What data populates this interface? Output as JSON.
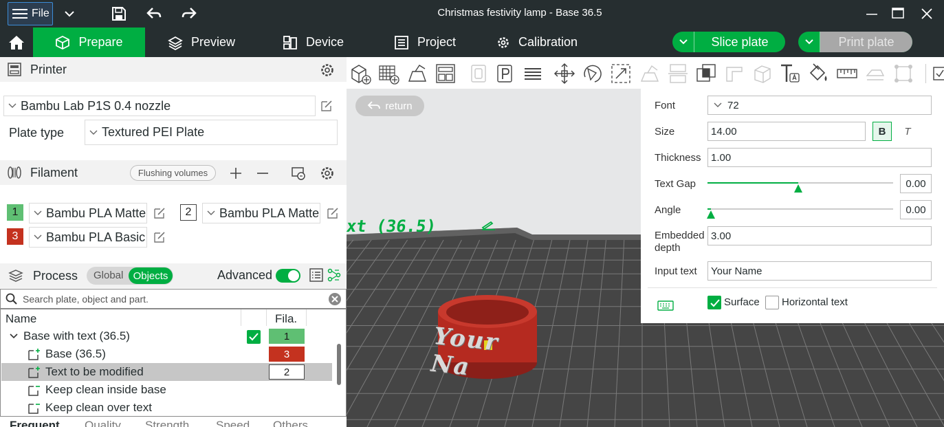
{
  "window": {
    "title": "Christmas festivity lamp - Base 36.5",
    "file_label": "File"
  },
  "menu": {
    "tabs": [
      {
        "label": "Prepare"
      },
      {
        "label": "Preview"
      },
      {
        "label": "Device"
      },
      {
        "label": "Project"
      },
      {
        "label": "Calibration"
      }
    ],
    "slice_label": "Slice plate",
    "print_label": "Print plate"
  },
  "printer": {
    "section_label": "Printer",
    "selected": "Bambu Lab P1S 0.4 nozzle",
    "plate_type_label": "Plate type",
    "plate_type": "Textured PEI Plate"
  },
  "filament": {
    "section_label": "Filament",
    "flushing_label": "Flushing volumes",
    "items": [
      {
        "num": "1",
        "name": "Bambu PLA Matte",
        "color": "#5fbf73"
      },
      {
        "num": "2",
        "name": "Bambu PLA Matte",
        "color": "#ffffff"
      },
      {
        "num": "3",
        "name": "Bambu PLA Basic",
        "color": "#c4321f"
      }
    ]
  },
  "process": {
    "section_label": "Process",
    "global_label": "Global",
    "objects_label": "Objects",
    "advanced_label": "Advanced",
    "search_placeholder": "Search plate, object and part."
  },
  "tree": {
    "col_name": "Name",
    "col_fila": "Fila.",
    "rows": [
      {
        "name": "Base with text (36.5)",
        "fila": "1"
      },
      {
        "name": "Base (36.5)",
        "fila": "3"
      },
      {
        "name": "Text to be modified",
        "fila": "2"
      },
      {
        "name": "Keep clean inside base",
        "fila": ""
      },
      {
        "name": "Keep clean over text",
        "fila": ""
      }
    ]
  },
  "bottom_tabs": [
    "Frequent",
    "Quality",
    "Strength",
    "Speed",
    "Others"
  ],
  "viewport": {
    "return_label": "return",
    "plate_label": "xt (36.5)",
    "model_text": "Your Na"
  },
  "text_panel": {
    "font_label": "Font",
    "font_value": "72",
    "size_label": "Size",
    "size_value": "14.00",
    "bold_label": "B",
    "italic_label": "T",
    "thickness_label": "Thickness",
    "thickness_value": "1.00",
    "text_gap_label": "Text Gap",
    "text_gap_value": "0.00",
    "text_gap_slider": 0.49,
    "angle_label": "Angle",
    "angle_value": "0.00",
    "angle_slider": 0.02,
    "embedded_label": "Embedded depth",
    "embedded_value": "3.00",
    "input_label": "Input text",
    "input_value": "Your Name",
    "surface_label": "Surface",
    "horizontal_label": "Horizontal text"
  }
}
